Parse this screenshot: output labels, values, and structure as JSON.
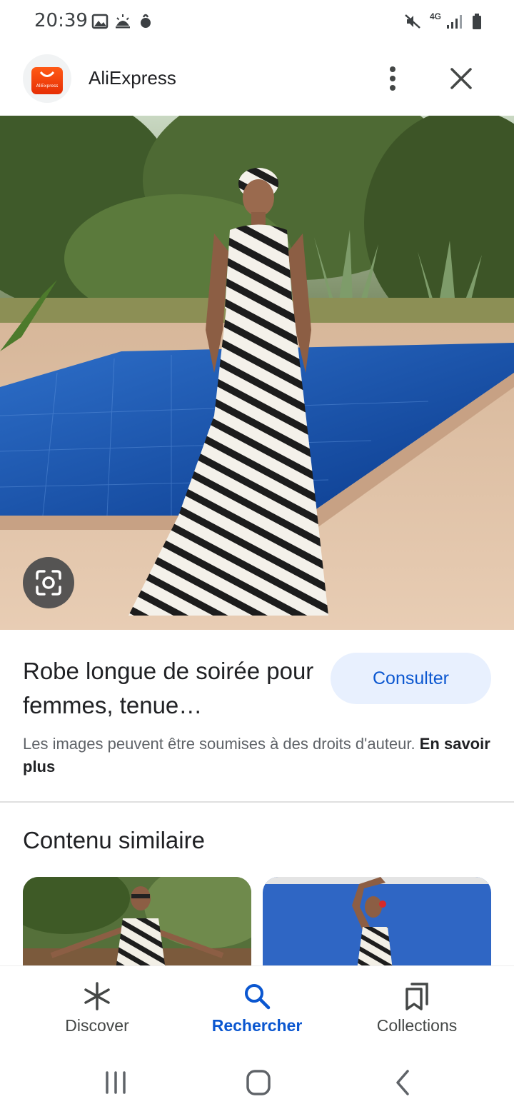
{
  "status_bar": {
    "time": "20:39",
    "network": "4G",
    "icons": [
      "gallery-icon",
      "weather-icon",
      "notification-icon",
      "mute-icon",
      "signal-icon",
      "battery-icon"
    ]
  },
  "header": {
    "app_name": "AliExpress",
    "logo_text": "AliExpress"
  },
  "result": {
    "title": "Robe longue de soirée pour femmes, tenue…",
    "consult_label": "Consulter",
    "copyright_text": "Les images peuvent être soumises à des droits d'auteur.",
    "learn_more_label": "En savoir plus"
  },
  "similar": {
    "heading": "Contenu similaire"
  },
  "bottom_nav": {
    "items": [
      {
        "label": "Discover",
        "icon": "asterisk-icon",
        "active": false
      },
      {
        "label": "Rechercher",
        "icon": "search-icon",
        "active": true
      },
      {
        "label": "Collections",
        "icon": "collections-icon",
        "active": false
      }
    ]
  },
  "system_nav": {
    "items": [
      "recent-apps-icon",
      "home-icon",
      "back-icon"
    ]
  },
  "colors": {
    "accent": "#0b57d0",
    "button_bg": "#e8f0fe",
    "aliexpress": "#e62e04"
  }
}
